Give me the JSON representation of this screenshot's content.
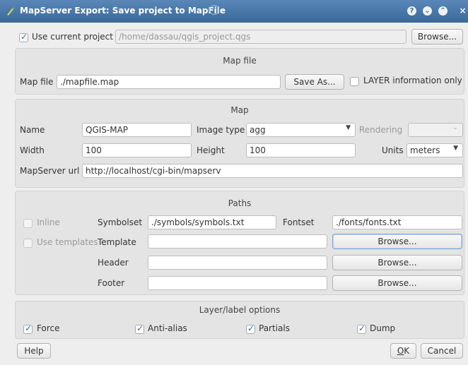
{
  "window": {
    "title": "MapServer Export: Save project to MapFile",
    "controls": [
      "?",
      "⌄",
      "⌃",
      "×"
    ]
  },
  "project": {
    "use_current_label": "Use current project",
    "use_current_checked": true,
    "path": "/home/dassau/qgis_project.qgs",
    "browse_label": "Browse..."
  },
  "mapfile_section": {
    "title": "Map file",
    "label": "Map file",
    "value": "./mapfile.map",
    "save_as_label": "Save As...",
    "layer_info_label": "LAYER information only",
    "layer_info_checked": false
  },
  "map_section": {
    "title": "Map",
    "name_label": "Name",
    "name_value": "QGIS-MAP",
    "image_type_label": "Image type",
    "image_type_value": "agg",
    "rendering_label": "Rendering",
    "rendering_value": "",
    "width_label": "Width",
    "width_value": "100",
    "height_label": "Height",
    "height_value": "100",
    "units_label": "Units",
    "units_value": "meters",
    "url_label": "MapServer url",
    "url_value": "http://localhost/cgi-bin/mapserv"
  },
  "paths_section": {
    "title": "Paths",
    "inline_label": "Inline",
    "symbolset_label": "Symbolset",
    "symbolset_value": "./symbols/symbols.txt",
    "fontset_label": "Fontset",
    "fontset_value": "./fonts/fonts.txt",
    "use_templates_label": "Use templates",
    "template_label": "Template",
    "template_value": "",
    "header_label": "Header",
    "header_value": "",
    "footer_label": "Footer",
    "footer_value": "",
    "browse_label": "Browse..."
  },
  "options_section": {
    "title": "Layer/label options",
    "options": [
      {
        "label": "Force",
        "checked": true
      },
      {
        "label": "Anti-alias",
        "checked": true
      },
      {
        "label": "Partials",
        "checked": true
      },
      {
        "label": "Dump",
        "checked": true
      }
    ]
  },
  "buttons": {
    "help": "Help",
    "ok_accel": "O",
    "ok_rest": "K",
    "cancel": "Cancel"
  },
  "colors": {
    "titlebar": "#3a6899",
    "window_bg": "#eeeeee",
    "panel_bg": "#e4e4e4",
    "check_accent": "#3a6899"
  }
}
